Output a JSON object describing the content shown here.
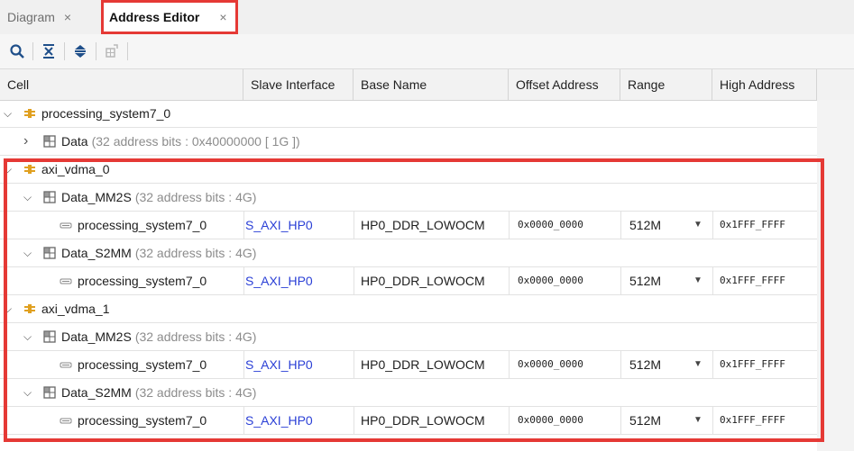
{
  "tabs": [
    {
      "label": "Diagram",
      "close": "×"
    },
    {
      "label": "Address Editor",
      "close": "×"
    }
  ],
  "toolbar": {
    "icons": [
      "search-icon",
      "collapse-all-icon",
      "expand-all-icon",
      "auto-assign-icon"
    ]
  },
  "columns": [
    "Cell",
    "Slave Interface",
    "Base Name",
    "Offset Address",
    "Range",
    "High Address"
  ],
  "rows": [
    {
      "label": "processing_system7_0"
    },
    {
      "label": "Data",
      "detail": "(32 address bits : 0x40000000 [ 1G ])"
    },
    {
      "label": "axi_vdma_0"
    },
    {
      "label": "Data_MM2S",
      "detail": "(32 address bits : 4G)"
    },
    {
      "label": "processing_system7_0",
      "slave": "S_AXI_HP0",
      "base": "HP0_DDR_LOWOCM",
      "offset": "0x0000_0000",
      "range": "512M",
      "high": "0x1FFF_FFFF"
    },
    {
      "label": "Data_S2MM",
      "detail": "(32 address bits : 4G)"
    },
    {
      "label": "processing_system7_0",
      "slave": "S_AXI_HP0",
      "base": "HP0_DDR_LOWOCM",
      "offset": "0x0000_0000",
      "range": "512M",
      "high": "0x1FFF_FFFF"
    },
    {
      "label": "axi_vdma_1"
    },
    {
      "label": "Data_MM2S",
      "detail": "(32 address bits : 4G)"
    },
    {
      "label": "processing_system7_0",
      "slave": "S_AXI_HP0",
      "base": "HP0_DDR_LOWOCM",
      "offset": "0x0000_0000",
      "range": "512M",
      "high": "0x1FFF_FFFF"
    },
    {
      "label": "Data_S2MM",
      "detail": "(32 address bits : 4G)"
    },
    {
      "label": "processing_system7_0",
      "slave": "S_AXI_HP0",
      "base": "HP0_DDR_LOWOCM",
      "offset": "0x0000_0000",
      "range": "512M",
      "high": "0x1FFF_FFFF"
    }
  ],
  "colors": {
    "highlight": "#e53935",
    "link": "#2a3fd6",
    "cell_icon": "#e0a020"
  }
}
